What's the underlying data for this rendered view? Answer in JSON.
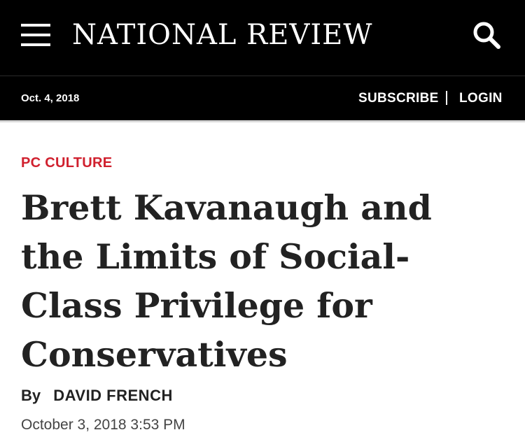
{
  "header": {
    "logo_text": "NATIONAL REVIEW",
    "menu_icon": "hamburger-menu-icon",
    "search_icon": "search-icon",
    "background_color": "#000000"
  },
  "subheader": {
    "date": "Oct. 4, 2018",
    "subscribe_label": "SUBSCRIBE",
    "login_label": "LOGIN"
  },
  "article": {
    "category": "PC CULTURE",
    "category_color": "#d0202e",
    "headline": "Brett Kavanaugh and the Limits of Social-Class Privilege for Conservatives",
    "byline_prefix": "By",
    "author": "DAVID FRENCH",
    "published": "October 3, 2018 3:53 PM"
  }
}
